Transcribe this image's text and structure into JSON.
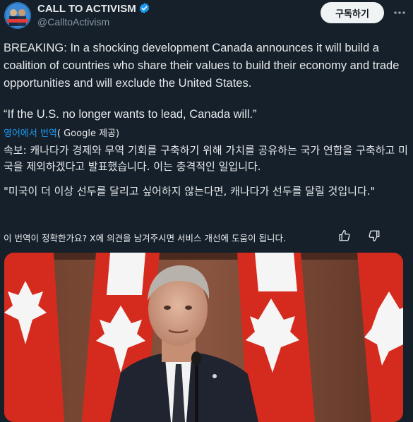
{
  "account": {
    "display_name": "CALL TO ACTIVISM",
    "handle": "@CalltoActivism",
    "subscribe_label": "구독하기",
    "avatar_icon": "activist-avatar-icon",
    "verified_icon": "verified-badge-icon"
  },
  "post": {
    "text": "BREAKING: In a shocking development Canada announces it will build a coalition of countries who share their values to build their economy and trade opportunities and will exclude the United States.",
    "quote": "“If the U.S. no longer wants to lead, Canada will.”"
  },
  "translation": {
    "link_label": "영어에서 번역",
    "provider_label": "( Google 제공)",
    "paragraph1": "속보: 캐나다가 경제와 무역 기회를 구축하기 위해 가치를 공유하는 국가 연합을 구축하고 미국을 제외하겠다고 발표했습니다. 이는 충격적인 일입니다.",
    "paragraph2": "\"미국이 더 이상 선두를 달리고 싶어하지 않는다면, 캐나다가 선두를 달릴 것입니다.\"",
    "feedback_prompt": "이 번역이 정확한가요? X에 의견을 남겨주시면 서비스 개선에 도움이 됩니다."
  },
  "icons": {
    "more": "more-options-icon",
    "thumbs_up": "thumbs-up-icon",
    "thumbs_down": "thumbs-down-icon"
  },
  "colors": {
    "background": "#15202b",
    "text": "#e7e9ea",
    "secondary_text": "#8b98a5",
    "accent": "#1d9bf0",
    "flag_red": "#d52b1e"
  }
}
